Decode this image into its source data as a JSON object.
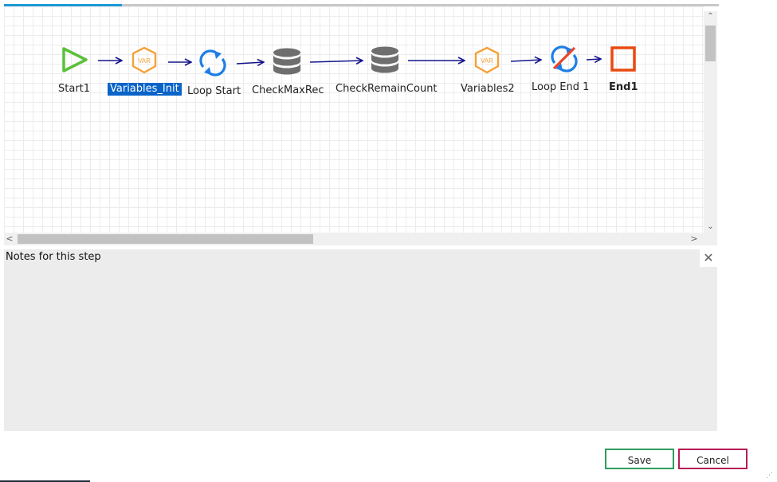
{
  "progress": {
    "fraction": 0.165
  },
  "flow": {
    "nodes": [
      {
        "name": "start1",
        "label": "Start1",
        "icon": "play-icon"
      },
      {
        "name": "variables-init",
        "label": "Variables_Init",
        "icon": "var-hexagon-icon",
        "selected": true
      },
      {
        "name": "loop-start",
        "label": "Loop Start",
        "icon": "loop-refresh-icon"
      },
      {
        "name": "checkmaxrec",
        "label": "CheckMaxRec",
        "icon": "database-icon"
      },
      {
        "name": "checkremaincount",
        "label": "CheckRemainCount",
        "icon": "database-icon"
      },
      {
        "name": "variables2",
        "label": "Variables2",
        "icon": "var-hexagon-icon"
      },
      {
        "name": "loop-end-1",
        "label": "Loop End 1",
        "icon": "loop-end-icon"
      },
      {
        "name": "end1",
        "label": "End1",
        "icon": "stop-square-icon",
        "bold": true
      }
    ],
    "var_badge": "VAR",
    "colors": {
      "start": "#5cc13a",
      "var": "#f5a23a",
      "loop": "#1e7ee6",
      "db": "#6e6e6e",
      "end": "#e84a10",
      "arrow": "#14148c",
      "loop_end_strike": "#e8472a"
    }
  },
  "scrollbars": {
    "up": "⌃",
    "down": "⌄",
    "left": "<",
    "right": ">"
  },
  "notes": {
    "label": "Notes for this step",
    "close": "✕"
  },
  "buttons": {
    "save": "Save",
    "cancel": "Cancel"
  }
}
